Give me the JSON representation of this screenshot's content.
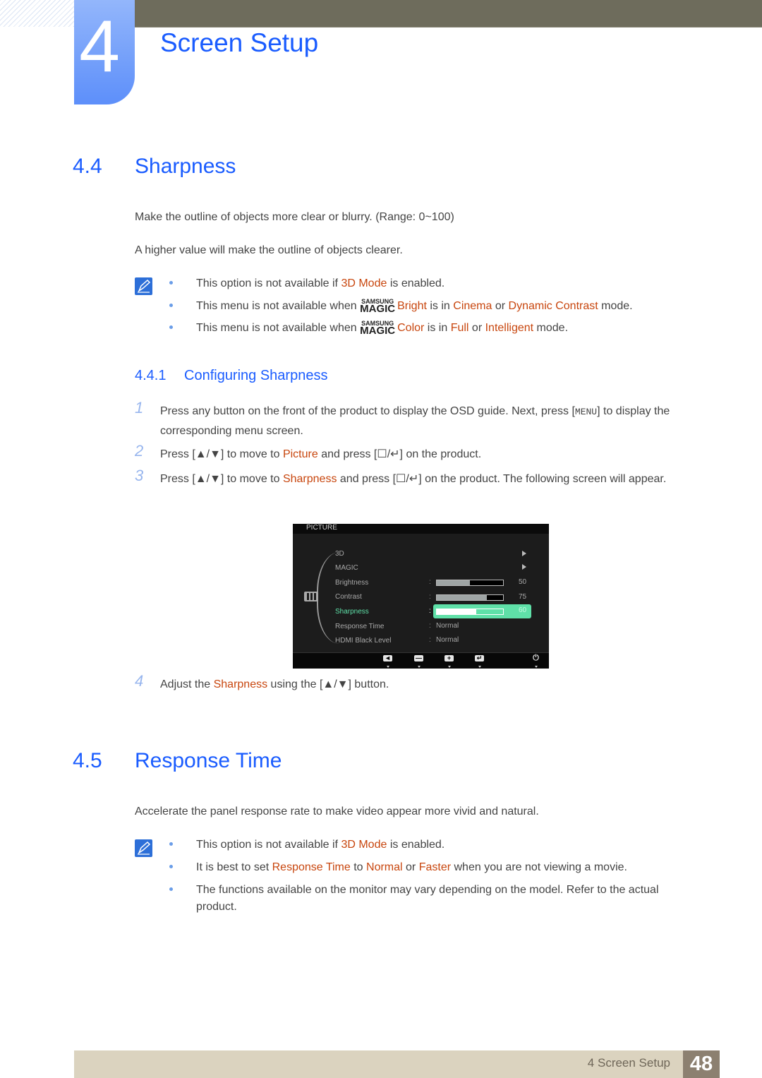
{
  "chapter": {
    "number": "4",
    "title": "Screen Setup"
  },
  "section_44": {
    "number": "4.4",
    "title": "Sharpness",
    "paragraphs": [
      "Make the outline of objects more clear or blurry. (Range: 0~100)",
      "A higher value will make the outline of objects clearer."
    ],
    "notes": [
      {
        "pre": "This option is not available if ",
        "hl1": "3D Mode",
        "post": " is enabled."
      },
      {
        "pre": "This menu is not available when ",
        "logo_top": "SAMSUNG",
        "logo_bottom": "MAGIC",
        "hl1": "Bright",
        "mid1": " is in ",
        "hl2": "Cinema",
        "mid2": " or ",
        "hl3": "Dynamic Contrast",
        "post": " mode."
      },
      {
        "pre": "This menu is not available when ",
        "logo_top": "SAMSUNG",
        "logo_bottom": "MAGIC",
        "hl1": "Color",
        "mid1": " is in ",
        "hl2": "Full",
        "mid2": " or ",
        "hl3": "Intelligent",
        "post": " mode."
      }
    ]
  },
  "subsection_441": {
    "number": "4.4.1",
    "title": "Configuring Sharpness",
    "steps": [
      {
        "num": "1",
        "pre": "Press any button on the front of the product to display the OSD guide. Next, press [",
        "key": "MENU",
        "post": "] to display the corresponding menu screen."
      },
      {
        "num": "2",
        "pre": "Press [▲/▼] to move to ",
        "hl": "Picture",
        "post": " and press [☐/↵] on the product."
      },
      {
        "num": "3",
        "pre": "Press [▲/▼] to move to ",
        "hl": "Sharpness",
        "post": " and press [☐/↵] on the product. The following screen will appear."
      },
      {
        "num": "4",
        "pre": "Adjust the ",
        "hl": "Sharpness",
        "post": " using the [▲/▼] button."
      }
    ]
  },
  "osd": {
    "header": "PICTURE",
    "items": [
      {
        "label": "3D",
        "type": "submenu"
      },
      {
        "label": "MAGIC",
        "type": "submenu"
      },
      {
        "label": "Brightness",
        "type": "slider",
        "value": 50
      },
      {
        "label": "Contrast",
        "type": "slider",
        "value": 75
      },
      {
        "label": "Sharpness",
        "type": "slider",
        "value": 60,
        "selected": true
      },
      {
        "label": "Response Time",
        "type": "text",
        "value": "Normal"
      },
      {
        "label": "HDMI Black Level",
        "type": "text",
        "value": "Normal"
      }
    ],
    "colon": ":",
    "footer_buttons": [
      "left-icon",
      "minus-icon",
      "plus-icon",
      "enter-icon",
      "power-icon"
    ],
    "footer_glyphs": [
      "◄",
      "—",
      "+",
      "↵",
      "⏻"
    ]
  },
  "section_45": {
    "number": "4.5",
    "title": "Response Time",
    "paragraph": "Accelerate the panel response rate to make video appear more vivid and natural.",
    "notes": [
      {
        "pre": "This option is not available if ",
        "hl1": "3D Mode",
        "post": " is enabled."
      },
      {
        "pre": "It is best to set ",
        "hl1": "Response Time",
        "mid1": " to ",
        "hl2": "Normal",
        "mid2": " or ",
        "hl3": "Faster",
        "post": " when you are not viewing a movie."
      },
      {
        "line1": "The functions available on the monitor may vary depending on the model. Refer to the actual",
        "line2": "product."
      }
    ]
  },
  "footer": {
    "label": "4 Screen Setup",
    "page": "48"
  },
  "colors": {
    "heading_blue": "#1a5cff",
    "highlight": "#c8460e",
    "osd_selected": "#5fe0a8"
  }
}
